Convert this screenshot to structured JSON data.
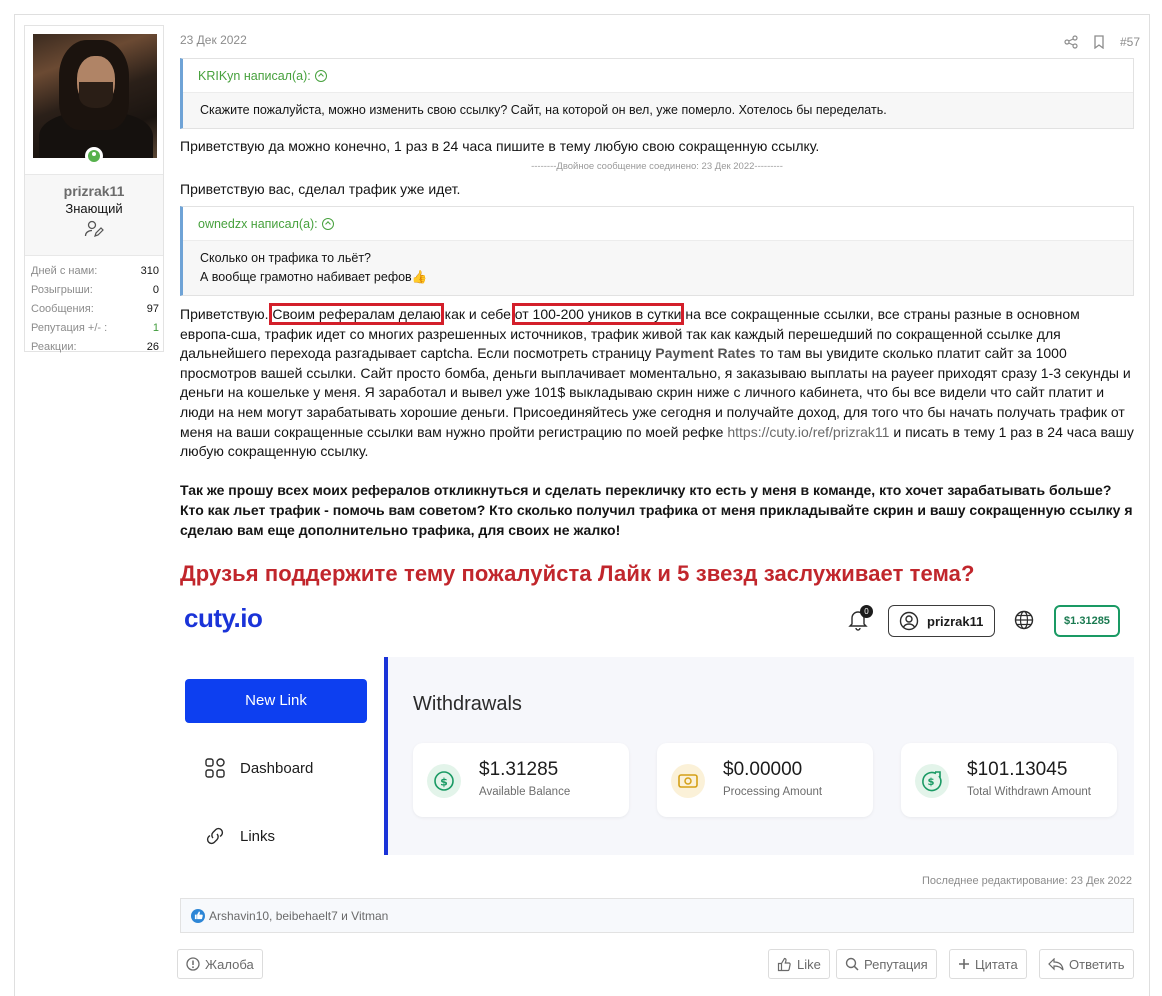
{
  "user": {
    "username": "prizrak11",
    "title": "Знающий",
    "stats": [
      {
        "label": "Дней с нами:",
        "value": "310"
      },
      {
        "label": "Розыгрыши:",
        "value": "0"
      },
      {
        "label": "Сообщения:",
        "value": "97"
      },
      {
        "label": "Репутация +/- :",
        "value": "1"
      },
      {
        "label": "Реакции:",
        "value": "26"
      }
    ]
  },
  "post": {
    "date": "23 Дек 2022",
    "number": "#57",
    "quote1": {
      "author": "KRIKyn написал(а):",
      "text": "Скажите пожалуйста, можно изменить свою ссылку? Сайт, на которой он вел, уже померло. Хотелось бы переделать."
    },
    "reply1": "Приветствую да можно конечно, 1 раз в 24 часа пишите в тему любую свою сокращенную ссылку.",
    "merged_note": "--------Двойное сообщение соединено: 23 Дек 2022---------",
    "reply2": "Приветствую вас, сделал трафик уже идет.",
    "quote2": {
      "author": "ownedzx написал(а):",
      "line1": "Сколько он трафика то льёт?",
      "line2": "А вообще грамотно набивает рефов👍"
    },
    "body": {
      "p1_start": "Приветствую.",
      "p1_hl1": "Своим рефералам делаю",
      "p1_mid": "как и себе",
      "p1_hl2": "от 100-200 уников в сутки",
      "p1_rest1": "на все сокращенные ссылки, все страны разные в основном европа-сша, трафик идет со многих разрешенных источников, трафик живой так как каждый перешедший по сокращенной ссылке для дальнейшего перехода разгадывает captcha. Если посмотреть страницу",
      "p1_link": "Payment Rates",
      "p1_rest2": "то там вы увидите сколько платит сайт за 1000 просмотров вашей ссылки. Сайт просто бомба, деньги выплачивает моментально, я заказываю выплаты на payeer приходят сразу 1-3 секунды и деньги на кошельке у меня. Я заработал и вывел уже 101$ выкладываю скрин ниже с личного кабинета, что бы все видели что сайт платит и люди на нем могут зарабатывать хорошие деньги. Присоединяйтесь уже сегодня и получайте доход, для того что бы начать получать трафик от меня на ваши сокращенные ссылки вам нужно пройти регистрацию по моей рефке",
      "p1_url": "https://cuty.io/ref/prizrak11",
      "p1_end": "и писать в тему 1 раз в 24 часа вашу любую сокращенную ссылку.",
      "p2": "Так же прошу всех моих рефералов откликнуться и сделать перекличку кто есть у меня в команде, кто хочет зарабатывать больше? Кто как льет трафик - помочь вам советом? Кто сколько получил трафика от меня прикладывайте скрин и вашу сокращенную ссылку я сделаю вам еще дополнительно трафика, для своих не жалко!",
      "p3": "Друзья поддержите тему пожалуйста Лайк и 5 звезд заслуживает тема?"
    },
    "last_edit": "Последнее редактирование: 23 Дек 2022",
    "reactions": {
      "users": "Arshavin10, beibehaelt7",
      "and_word": "и",
      "last_user": "Vitman"
    },
    "buttons": {
      "report": "Жалоба",
      "like": "Like",
      "reputation": "Репутация",
      "quote": "Цитата",
      "reply": "Ответить"
    }
  },
  "screenshot": {
    "logo": "cuty.io",
    "notif_count": "0",
    "username": "prizrak11",
    "balance_pill": "$1.31285",
    "new_link": "New Link",
    "menu": [
      "Dashboard",
      "Links"
    ],
    "page_title": "Withdrawals",
    "cards": [
      {
        "amount": "$1.31285",
        "label": "Available Balance",
        "color": "#e3f4ea",
        "icon": "dollar-icon"
      },
      {
        "amount": "$0.00000",
        "label": "Processing Amount",
        "color": "#fbf1d8",
        "icon": "cash-icon"
      },
      {
        "amount": "$101.13045",
        "label": "Total Withdrawn Amount",
        "color": "#e3f4ea",
        "icon": "withdrawn-icon"
      }
    ]
  },
  "colors": {
    "accent_green": "#47a13d",
    "highlight_red": "#d31f2a",
    "title_red": "#c1262c",
    "cuty_blue": "#1a33d8"
  }
}
